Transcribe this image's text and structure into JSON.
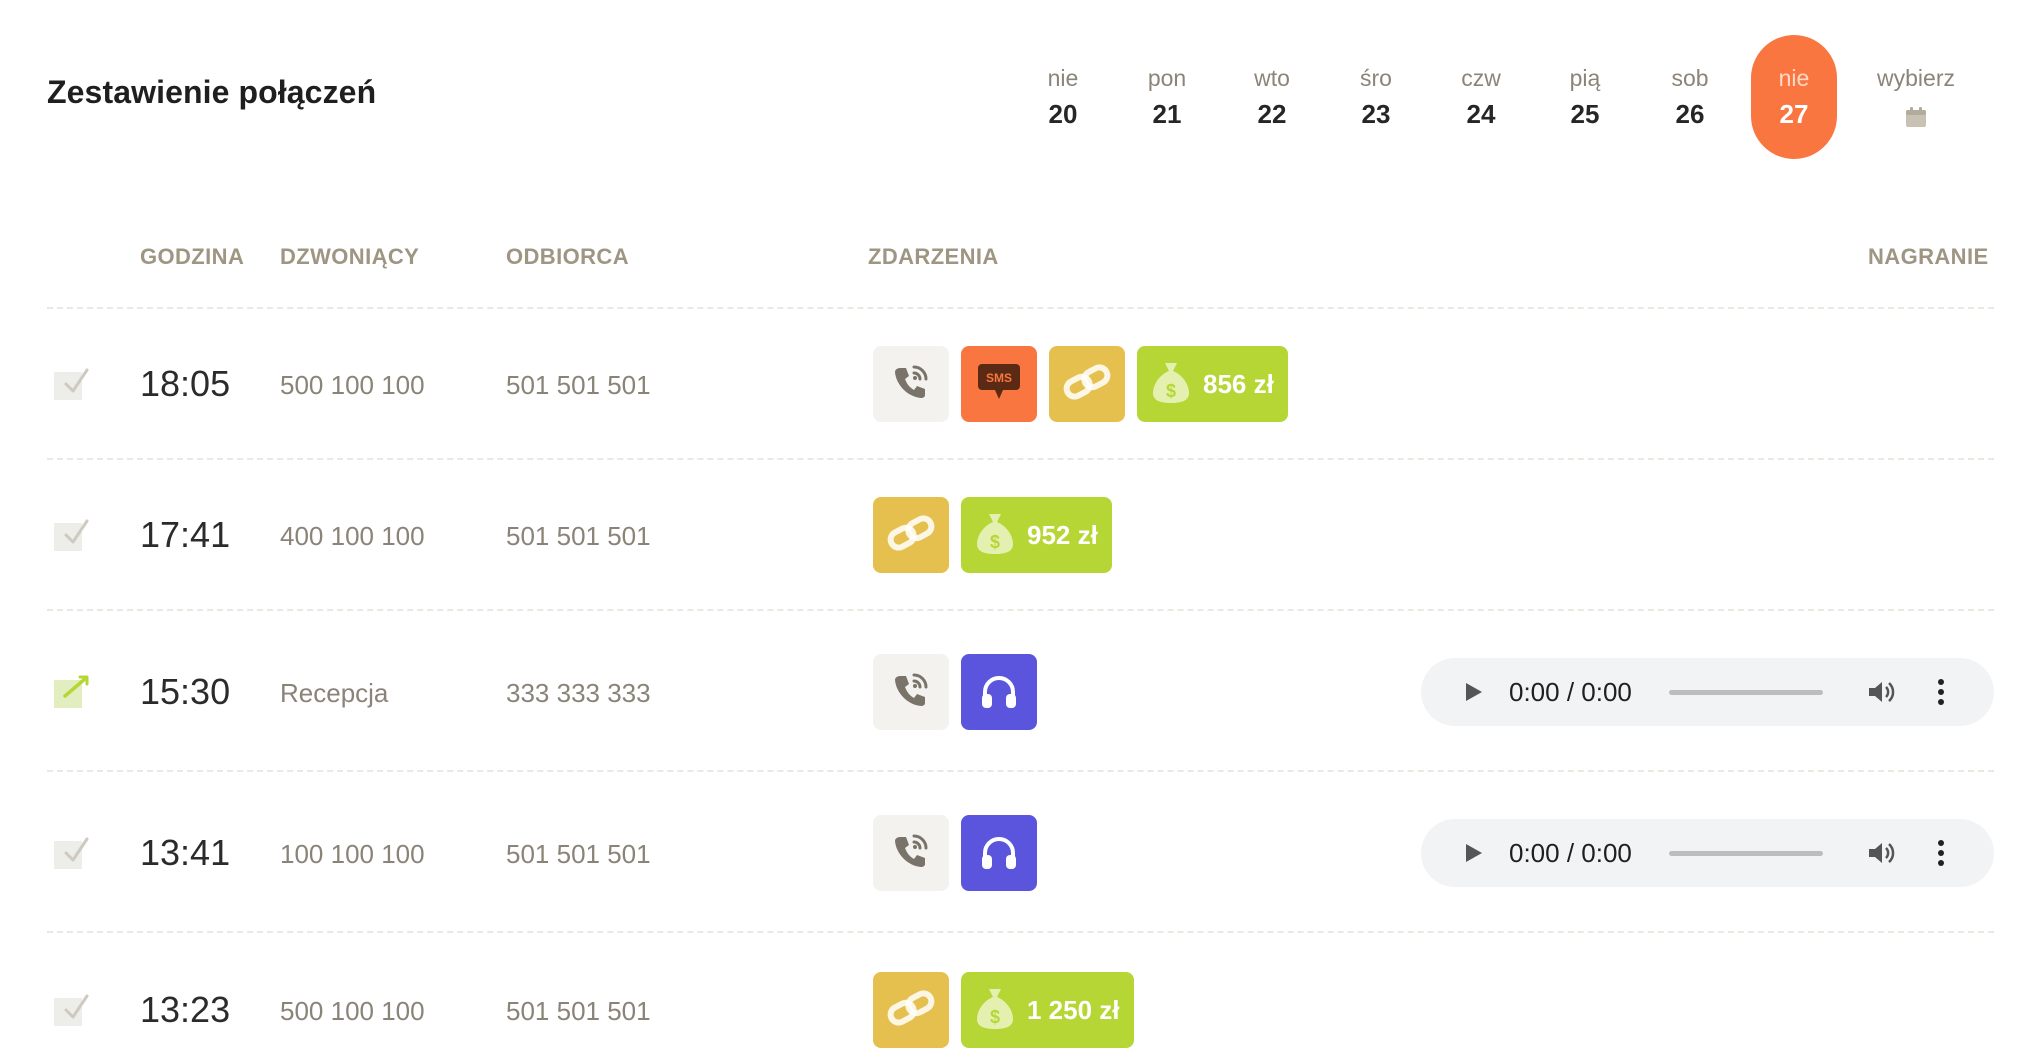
{
  "page": {
    "title": "Zestawienie połączeń"
  },
  "days": [
    {
      "name": "nie",
      "num": "20",
      "active": false
    },
    {
      "name": "pon",
      "num": "21",
      "active": false
    },
    {
      "name": "wto",
      "num": "22",
      "active": false
    },
    {
      "name": "śro",
      "num": "23",
      "active": false
    },
    {
      "name": "czw",
      "num": "24",
      "active": false
    },
    {
      "name": "pią",
      "num": "25",
      "active": false
    },
    {
      "name": "sob",
      "num": "26",
      "active": false
    },
    {
      "name": "nie",
      "num": "27",
      "active": true
    }
  ],
  "picker": {
    "label": "wybierz",
    "icon": "calendar-icon"
  },
  "columns": {
    "time": "GODZINA",
    "caller": "DZWONIĄCY",
    "callee": "ODBIORCA",
    "events": "ZDARZENIA",
    "recording": "NAGRANIE"
  },
  "rows": [
    {
      "time": "18:05",
      "caller": "500 100 100",
      "callee": "501 501 501",
      "marked": false,
      "events": [
        {
          "type": "call"
        },
        {
          "type": "sms",
          "label": "SMS"
        },
        {
          "type": "link"
        },
        {
          "type": "money",
          "amount": "856 zł"
        }
      ],
      "player": null
    },
    {
      "time": "17:41",
      "caller": "400 100 100",
      "callee": "501 501 501",
      "marked": false,
      "events": [
        {
          "type": "link"
        },
        {
          "type": "money",
          "amount": "952 zł"
        }
      ],
      "player": null
    },
    {
      "time": "15:30",
      "caller": "Recepcja",
      "callee": "333 333 333",
      "marked": true,
      "events": [
        {
          "type": "call"
        },
        {
          "type": "recording"
        }
      ],
      "player": {
        "time": "0:00 / 0:00"
      }
    },
    {
      "time": "13:41",
      "caller": "100 100 100",
      "callee": "501 501 501",
      "marked": false,
      "events": [
        {
          "type": "call"
        },
        {
          "type": "recording"
        }
      ],
      "player": {
        "time": "0:00 / 0:00"
      }
    },
    {
      "time": "13:23",
      "caller": "500 100 100",
      "callee": "501 501 501",
      "marked": false,
      "events": [
        {
          "type": "link"
        },
        {
          "type": "money",
          "amount": "1 250 zł"
        }
      ],
      "player": null
    }
  ],
  "colors": {
    "accent": "#f97640",
    "link": "#e6c04e",
    "money": "#b6d636",
    "recording": "#5b55de",
    "call": "#f4f2ee",
    "header_text": "#9e9583",
    "muted_text": "#8a8478",
    "marked_check": "#b6d636"
  }
}
